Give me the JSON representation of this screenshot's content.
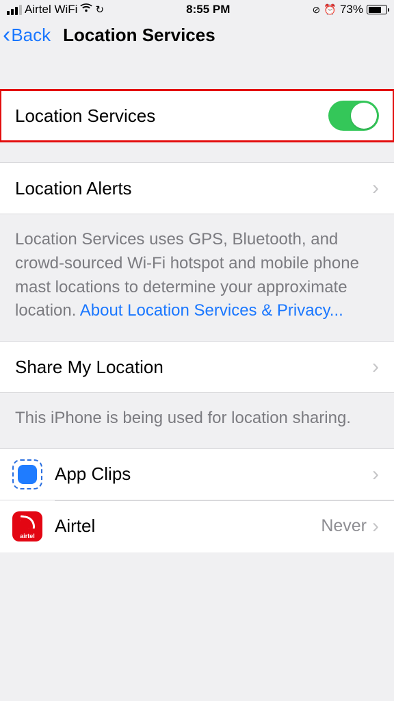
{
  "status": {
    "carrier": "Airtel WiFi",
    "time": "8:55 PM",
    "battery_pct": "73%"
  },
  "nav": {
    "back_label": "Back",
    "title": "Location Services"
  },
  "rows": {
    "location_services_label": "Location Services",
    "location_alerts_label": "Location Alerts",
    "share_my_location_label": "Share My Location"
  },
  "descriptions": {
    "services_info": "Location Services uses GPS, Bluetooth, and crowd-sourced Wi-Fi hotspot and mobile phone mast locations to determine your approximate location. ",
    "services_link": "About Location Services & Privacy...",
    "share_info": "This iPhone is being used for location sharing."
  },
  "apps": {
    "app_clips_label": "App Clips",
    "airtel_label": "Airtel",
    "airtel_value": "Never",
    "airtel_icon_text": "airtel"
  },
  "toggle": {
    "location_services_on": true
  }
}
